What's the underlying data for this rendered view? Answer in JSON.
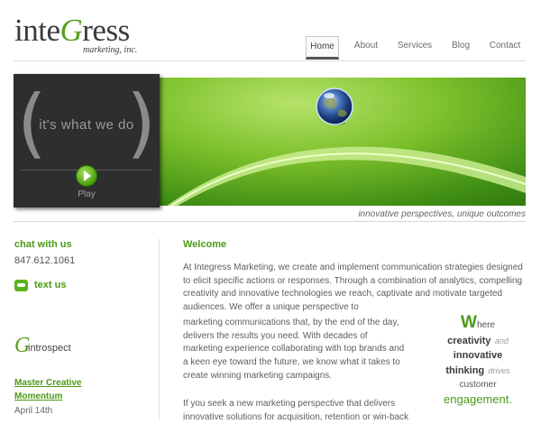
{
  "brand": {
    "logo_prefix": "inte",
    "logo_g": "G",
    "logo_suffix": "ress",
    "tagline": "marketing, inc."
  },
  "nav": {
    "items": [
      {
        "label": "Home",
        "active": true
      },
      {
        "label": "About"
      },
      {
        "label": "Services"
      },
      {
        "label": "Blog"
      },
      {
        "label": "Contact"
      }
    ]
  },
  "video": {
    "tagline": "it's what we do",
    "play_label": "Play",
    "icon": "play-icon"
  },
  "hero": {
    "caption": "innovative perspectives, unique outcomes"
  },
  "sidebar": {
    "chat_title": "chat with us",
    "phone": "847.612.1061",
    "text_us_label": "text us",
    "text_us_icon": "chat-bubble-icon",
    "introspect_g": "G",
    "introspect_label": "introspect",
    "post_title": "Master Creative Momentum",
    "post_date": "April 14th"
  },
  "main": {
    "title": "Welcome",
    "paragraphs": [
      "At Integress Marketing, we create and implement communication strategies designed to elicit specific actions or responses. Through a combination of analytics, compelling creativity and innovative technologies we reach, captivate and motivate targeted audiences. We offer a unique perspective to",
      "marketing communications that, by the end of the day, delivers the results you need. With decades of marketing experience collaborating with top brands and a keen eye toward the future, we know what it takes to create winning marketing campaigns.",
      "If you seek a new marketing perspective that delivers innovative solutions for acquisition, retention or win-back"
    ]
  },
  "callout": {
    "w_letter": "W",
    "w_rest": "here",
    "creativity": "creativity",
    "and": "and",
    "innovative": "innovative",
    "thinking": "thinking",
    "drives": "drives",
    "customer": "customer",
    "engagement": "engagement."
  },
  "colors": {
    "brand_green": "#4a9a16",
    "dark_gray": "#3b3b3b",
    "panel_bg": "#2e2e2e"
  }
}
